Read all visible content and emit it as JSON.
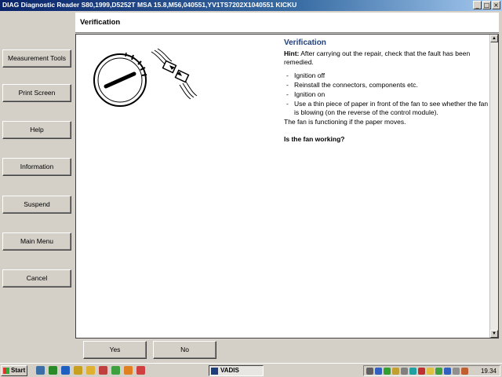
{
  "window": {
    "title": "DIAG Diagnostic Reader S80,1999,D5252T MSA 15.8,M56,040551,YV1TS7202X1040551 KICKU",
    "controls": {
      "minimize": "_",
      "maximize": "□",
      "close": "×"
    }
  },
  "nav": {
    "items": [
      {
        "label": "Measurement Tools"
      },
      {
        "label": "Print Screen"
      },
      {
        "label": "Help"
      },
      {
        "label": "Information"
      },
      {
        "label": "Suspend"
      },
      {
        "label": "Main Menu"
      },
      {
        "label": "Cancel"
      }
    ]
  },
  "header": {
    "title": "Verification"
  },
  "content": {
    "heading": "Verification",
    "hint_label": "Hint:",
    "hint_text": " After carrying out the repair, check that the fault has been remedied.",
    "steps": [
      "Ignition off",
      "Reinstall the connectors, components etc.",
      "Ignition on",
      "Use a thin piece of paper in front of the fan to see whether the fan is blowing (on the reverse of the control module)."
    ],
    "note": "The fan is functioning if the paper moves.",
    "question": "Is the fan working?"
  },
  "actions": {
    "yes": "Yes",
    "no": "No"
  },
  "taskbar": {
    "start": "Start",
    "active_task": "VADIS",
    "clock": "19.34"
  },
  "colors": {
    "heading": "#1f3f7a",
    "titlebar": "#0a246a",
    "chrome": "#d4d0c8"
  },
  "icons": [
    "ignition-switch-icon",
    "connector-disconnect-icon",
    "start-flag-icon"
  ]
}
